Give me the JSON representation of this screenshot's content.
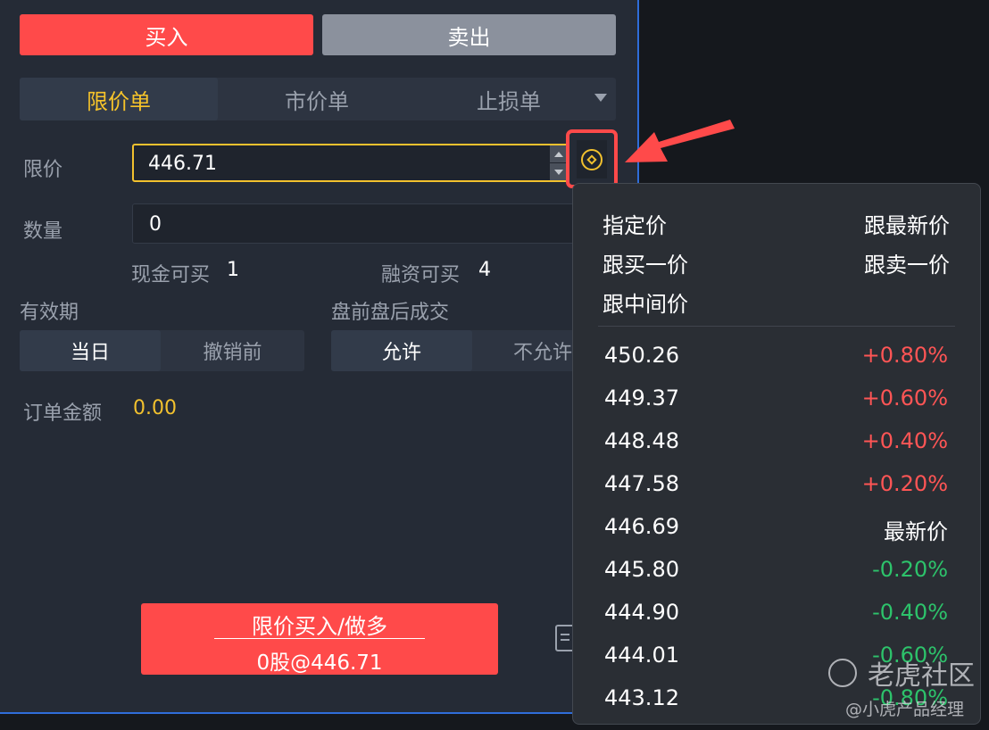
{
  "side_tabs": {
    "buy": "买入",
    "sell": "卖出"
  },
  "order_types": [
    {
      "label": "限价单",
      "active": true
    },
    {
      "label": "市价单",
      "active": false
    },
    {
      "label": "止损单",
      "active": false
    }
  ],
  "limit": {
    "label": "限价",
    "value": "446.71"
  },
  "quantity": {
    "label": "数量",
    "value": "0"
  },
  "buying_power": {
    "cash_label": "现金可买",
    "cash_value": "1",
    "margin_label": "融资可买",
    "margin_value": "4"
  },
  "validity": {
    "label": "有效期",
    "options": [
      "当日",
      "撤销前"
    ],
    "selected": "当日"
  },
  "extended_hours": {
    "label": "盘前盘后成交",
    "options": [
      "允许",
      "不允许"
    ],
    "selected": "允许"
  },
  "order_amount": {
    "label": "订单金额",
    "value": "0.00"
  },
  "submit": {
    "line1": "限价买入/做多",
    "line2": "0股@446.71"
  },
  "price_popup": {
    "modes": [
      "指定价",
      "跟最新价",
      "跟买一价",
      "跟卖一价",
      "跟中间价"
    ],
    "levels": [
      {
        "price": "450.26",
        "change": "+0.80%",
        "dir": "up"
      },
      {
        "price": "449.37",
        "change": "+0.60%",
        "dir": "up"
      },
      {
        "price": "448.48",
        "change": "+0.40%",
        "dir": "up"
      },
      {
        "price": "447.58",
        "change": "+0.20%",
        "dir": "up"
      },
      {
        "price": "446.69",
        "change": "最新价",
        "dir": "neutral"
      },
      {
        "price": "445.80",
        "change": "-0.20%",
        "dir": "down"
      },
      {
        "price": "444.90",
        "change": "-0.40%",
        "dir": "down"
      },
      {
        "price": "444.01",
        "change": "-0.60%",
        "dir": "down"
      },
      {
        "price": "443.12",
        "change": "-0.80%",
        "dir": "down"
      }
    ]
  },
  "watermark": {
    "brand": "老虎社区",
    "author": "@小虎产品经理"
  },
  "colors": {
    "buy_red": "#ff4a4a",
    "sell_gray": "#8b919d",
    "accent_yellow": "#f2c12e",
    "up": "#ff5555",
    "down": "#2dc36b",
    "highlight_border": "#2f6dd9"
  }
}
